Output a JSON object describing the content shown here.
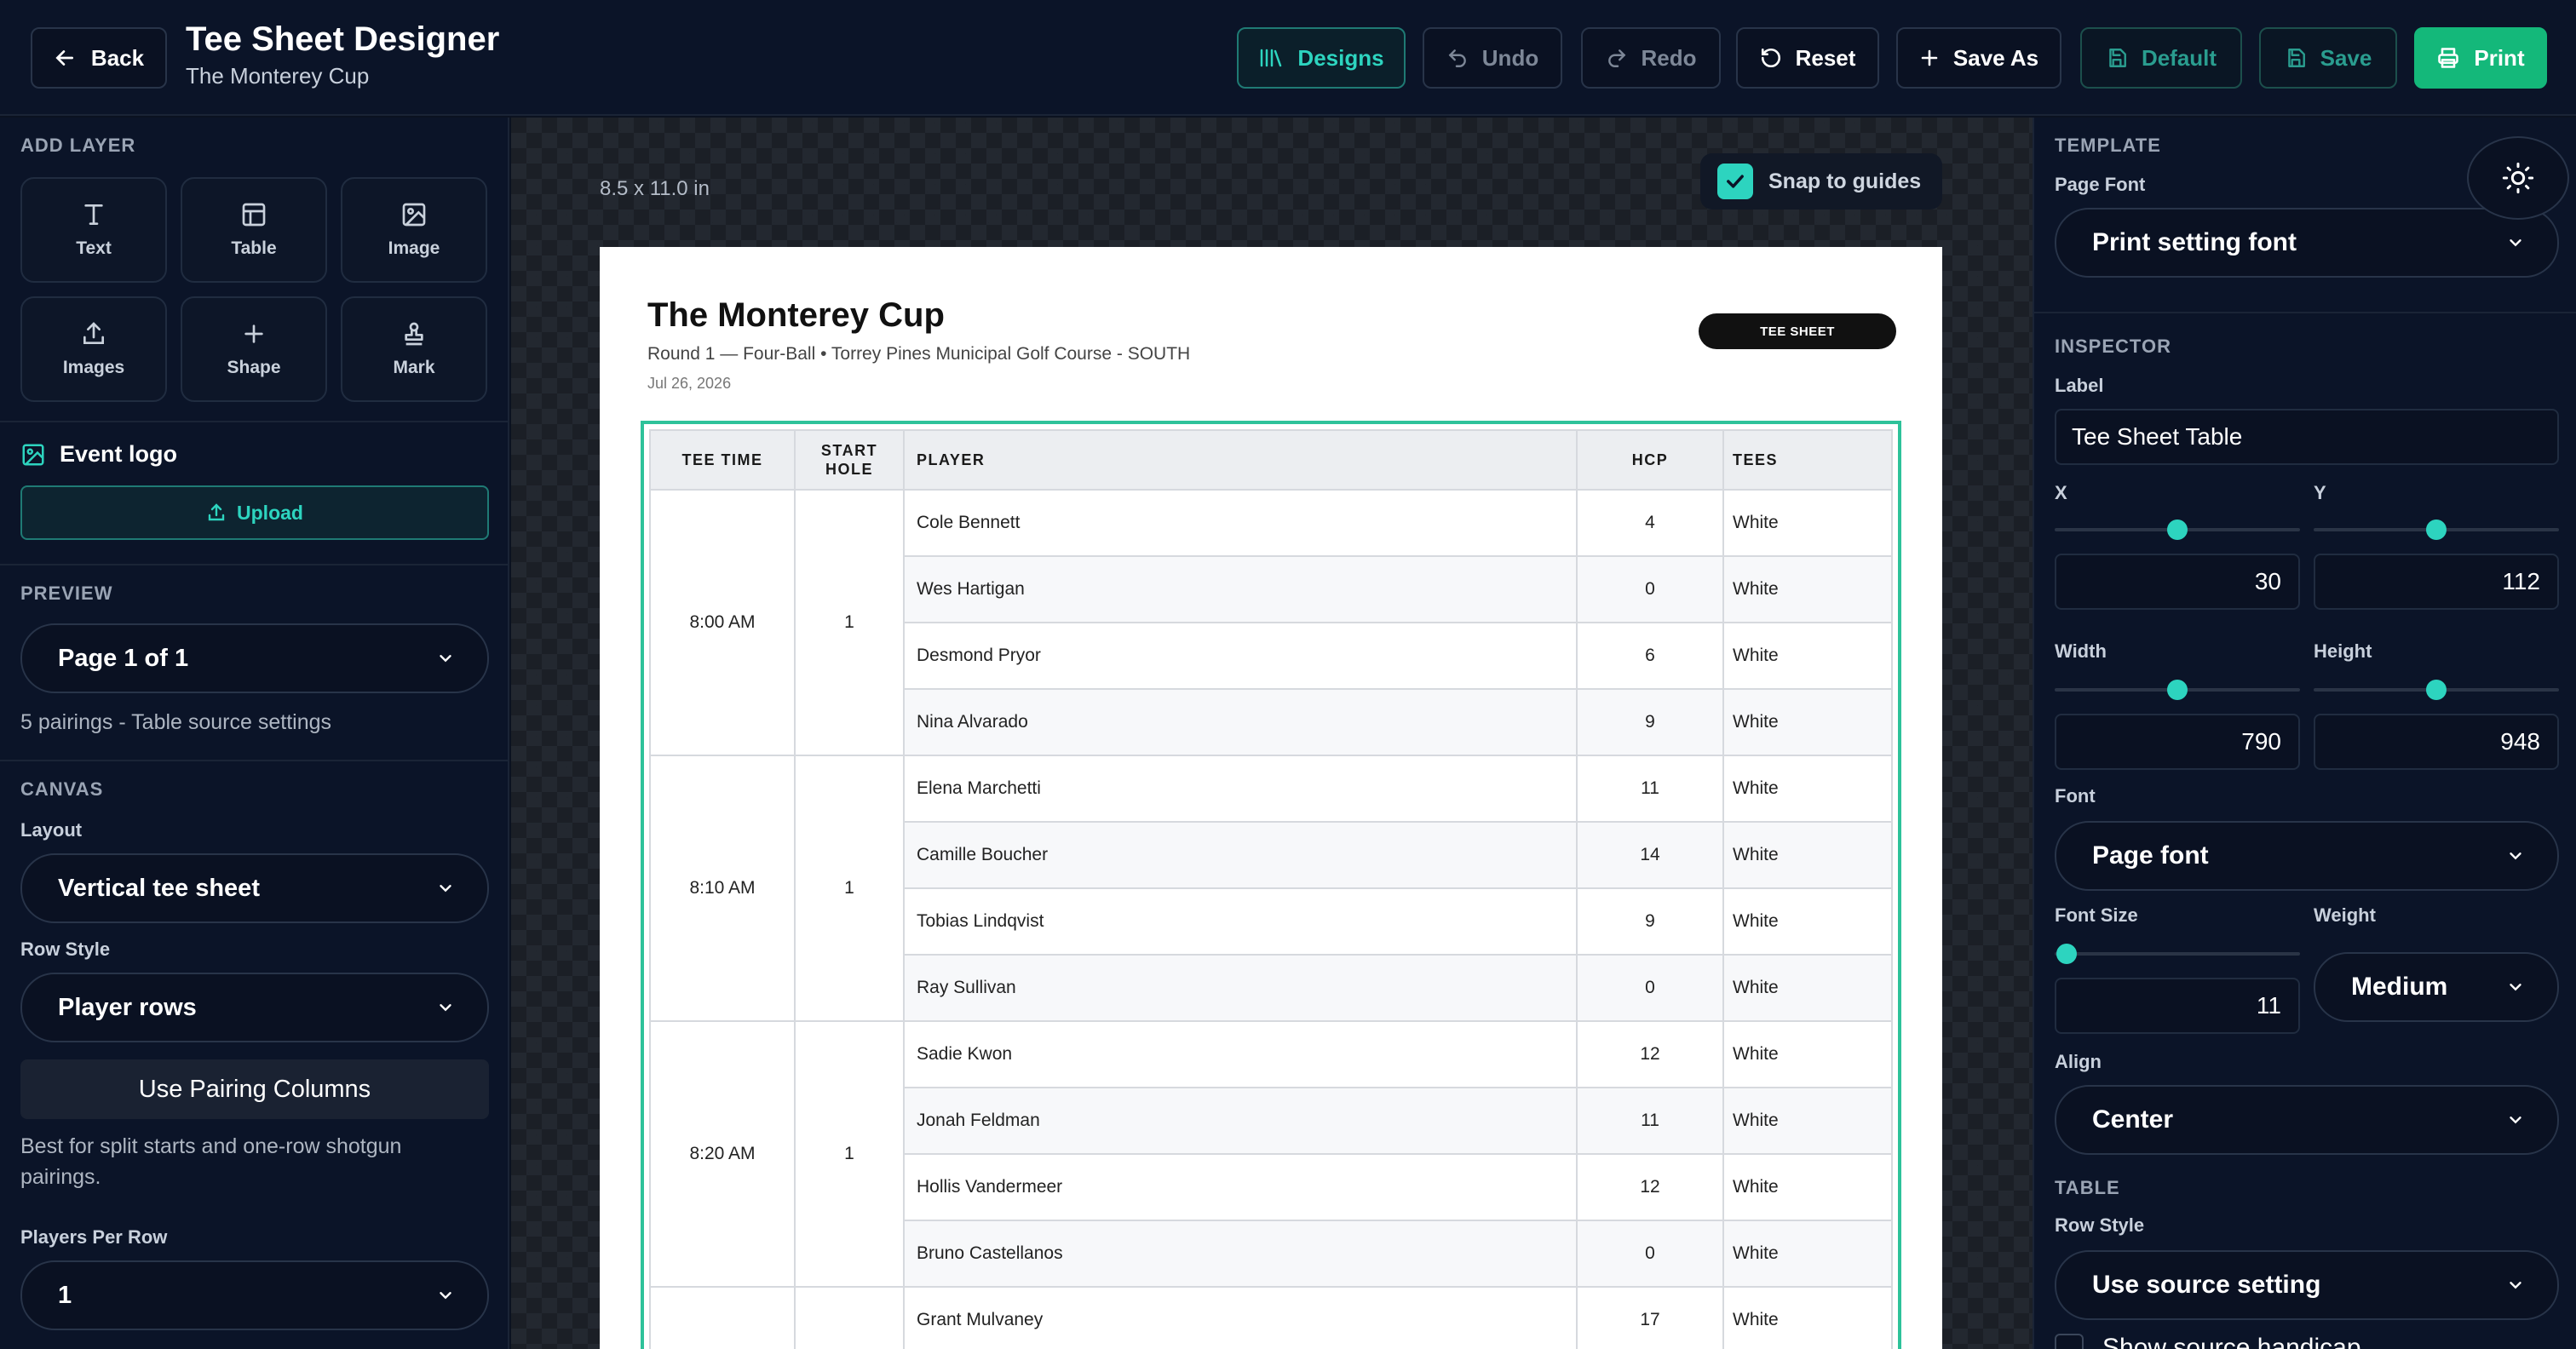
{
  "header": {
    "back_label": "Back",
    "title": "Tee Sheet Designer",
    "subtitle": "The Monterey Cup",
    "buttons": {
      "designs": "Designs",
      "undo": "Undo",
      "redo": "Redo",
      "reset": "Reset",
      "save_as": "Save As",
      "default": "Default",
      "save": "Save",
      "print": "Print"
    }
  },
  "left": {
    "add_layer_label": "ADD LAYER",
    "tools": [
      "Text",
      "Table",
      "Image",
      "Images",
      "Shape",
      "Mark"
    ],
    "event_logo_label": "Event logo",
    "upload_label": "Upload",
    "preview_label": "PREVIEW",
    "preview_page": "Page 1 of 1",
    "preview_helper": "5 pairings - Table source settings",
    "canvas_label": "CANVAS",
    "layout_label": "Layout",
    "layout_value": "Vertical tee sheet",
    "row_style_label": "Row Style",
    "row_style_value": "Player rows",
    "pairing_button": "Use Pairing Columns",
    "pairing_helper": "Best for split starts and one-row shotgun pairings.",
    "players_per_row_label": "Players Per Row",
    "players_per_row_value": "1"
  },
  "canvas": {
    "page_size": "8.5 x 11.0 in",
    "snap_label": "Snap to guides",
    "snap_checked": true
  },
  "document": {
    "title": "The Monterey Cup",
    "subtitle": "Round 1 — Four-Ball • Torrey Pines Municipal Golf Course - SOUTH",
    "date": "Jul 26, 2026",
    "badge": "TEE SHEET",
    "columns": [
      "TEE TIME",
      "START HOLE",
      "PLAYER",
      "HCP",
      "TEES"
    ],
    "groups": [
      {
        "time": "8:00 AM",
        "hole": "1",
        "players": [
          {
            "name": "Cole Bennett",
            "hcp": "4",
            "tees": "White"
          },
          {
            "name": "Wes Hartigan",
            "hcp": "0",
            "tees": "White"
          },
          {
            "name": "Desmond Pryor",
            "hcp": "6",
            "tees": "White"
          },
          {
            "name": "Nina Alvarado",
            "hcp": "9",
            "tees": "White"
          }
        ]
      },
      {
        "time": "8:10 AM",
        "hole": "1",
        "players": [
          {
            "name": "Elena Marchetti",
            "hcp": "11",
            "tees": "White"
          },
          {
            "name": "Camille Boucher",
            "hcp": "14",
            "tees": "White"
          },
          {
            "name": "Tobias Lindqvist",
            "hcp": "9",
            "tees": "White"
          },
          {
            "name": "Ray Sullivan",
            "hcp": "0",
            "tees": "White"
          }
        ]
      },
      {
        "time": "8:20 AM",
        "hole": "1",
        "players": [
          {
            "name": "Sadie Kwon",
            "hcp": "12",
            "tees": "White"
          },
          {
            "name": "Jonah Feldman",
            "hcp": "11",
            "tees": "White"
          },
          {
            "name": "Hollis Vandermeer",
            "hcp": "12",
            "tees": "White"
          },
          {
            "name": "Bruno Castellanos",
            "hcp": "0",
            "tees": "White"
          }
        ]
      },
      {
        "time": "",
        "hole": "",
        "players": [
          {
            "name": "Grant Mulvaney",
            "hcp": "17",
            "tees": "White"
          }
        ]
      }
    ]
  },
  "right": {
    "template_label": "TEMPLATE",
    "page_font_label": "Page Font",
    "page_font_value": "Print setting font",
    "inspector_label": "INSPECTOR",
    "label_label": "Label",
    "label_value": "Tee Sheet Table",
    "x_label": "X",
    "x_value": "30",
    "x_slider": 0.5,
    "y_label": "Y",
    "y_value": "112",
    "y_slider": 0.5,
    "width_label": "Width",
    "width_value": "790",
    "width_slider": 0.5,
    "height_label": "Height",
    "height_value": "948",
    "height_slider": 0.5,
    "font_label": "Font",
    "font_value": "Page font",
    "font_size_label": "Font Size",
    "font_size_value": "11",
    "font_size_slider": 0.05,
    "weight_label": "Weight",
    "weight_value": "Medium",
    "align_label": "Align",
    "align_value": "Center",
    "table_label": "TABLE",
    "row_style_label": "Row Style",
    "row_style_value": "Use source setting",
    "show_handicap_label": "Show source handicap"
  },
  "colors": {
    "accent": "#2dd4bf",
    "print_button": "#14b87a",
    "selection_border": "#2ec29a",
    "background": "#0b1428"
  }
}
